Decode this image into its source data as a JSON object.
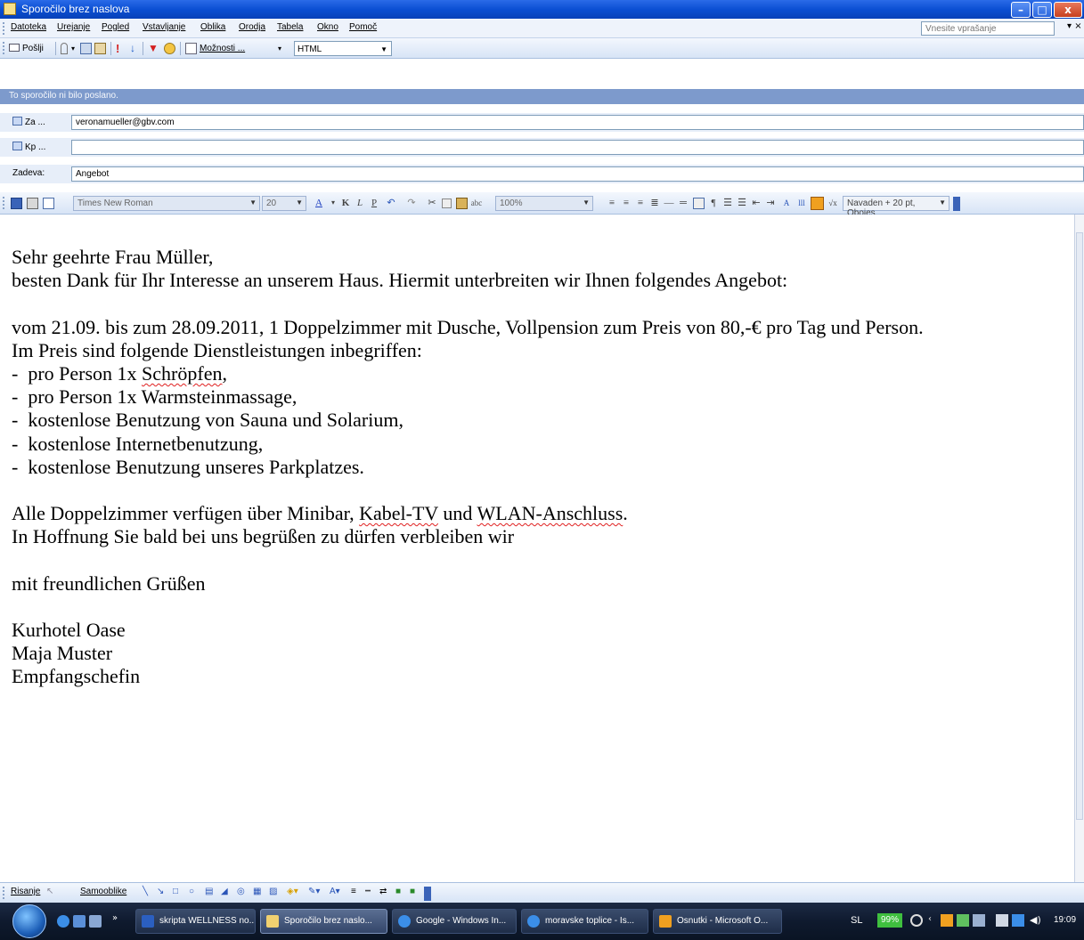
{
  "window": {
    "title": "Sporočilo brez naslova"
  },
  "menu": [
    "Datoteka",
    "Urejanje",
    "Pogled",
    "Vstavljanje",
    "Oblika",
    "Orodja",
    "Tabela",
    "Okno",
    "Pomoč"
  ],
  "help_box": {
    "placeholder": "Vnesite vprašanje"
  },
  "standard_toolbar": {
    "send_label": "Pošlji",
    "options_label": "Možnosti ...",
    "format_value": "HTML"
  },
  "notice": "To sporočilo ni bilo poslano.",
  "header": {
    "to_label": "Za ...",
    "to_value": "veronamueller@gbv.com",
    "cc_label": "Kp ...",
    "cc_value": "",
    "subject_label": "Zadeva:",
    "subject_value": "Angebot"
  },
  "format_toolbar": {
    "font": "Times New Roman",
    "size": "20",
    "zoom": "100%",
    "style": "Navaden + 20 pt, Obojes"
  },
  "letter": {
    "greeting": "Sehr geehrte Frau Müller,",
    "intro": "besten Dank für Ihr Interesse an unserem Haus. Hiermit unterbreiten wir Ihnen folgendes Angebot:",
    "offer": "vom 21.09. bis zum 28.09.2011, 1 Doppelzimmer mit Dusche, Vollpension zum Preis von 80,-€ pro Tag und Person.",
    "included_intro": "Im Preis sind folgende Dienstleistungen inbegriffen:",
    "services": [
      "pro Person 1x ",
      "pro Person 1x Warmsteinmassage,",
      "kostenlose Benutzung von Sauna und Solarium,",
      "kostenlose Internetbenutzung,",
      "kostenlose Benutzung unseres Parkplatzes."
    ],
    "service_0_word": "Schröpfen",
    "service_0_tail": ",",
    "rooms_a": "Alle Doppelzimmer verfügen über Minibar, ",
    "rooms_kabel": "Kabel-TV",
    "rooms_b": " und ",
    "rooms_wlan": "WLAN-Anschluss",
    "rooms_c": ".",
    "hope": "In Hoffnung Sie bald bei uns begrüßen zu dürfen verbleiben wir",
    "closing": "mit freundlichen Grüßen",
    "sig_hotel": "Kurhotel Oase",
    "sig_name": "Maja Muster",
    "sig_role": "Empfangschefin"
  },
  "drawing_toolbar": {
    "draw_label": "Risanje",
    "autoshapes_label": "Samooblike"
  },
  "taskbar": {
    "tasks": [
      "skripta WELLNESS no...",
      "Sporočilo brez naslo...",
      "Google - Windows In...",
      "moravske toplice - Is...",
      "Osnutki - Microsoft O..."
    ],
    "language": "SL",
    "battery": "99%",
    "clock": "19:09"
  },
  "colors": {
    "title_blue": "#0b4fd3",
    "notice_bar": "#7d9acc",
    "spell_error": "#e02020"
  }
}
